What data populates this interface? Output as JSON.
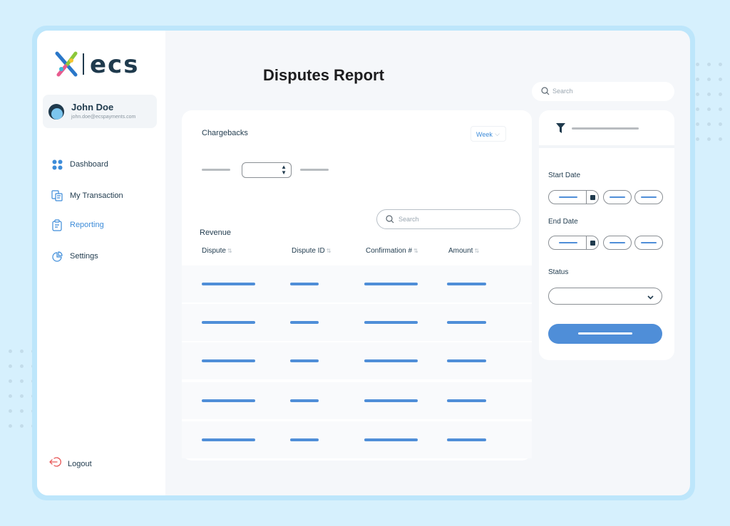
{
  "brand": {
    "wordmark": "ecs"
  },
  "user": {
    "name": "John Doe",
    "email": "john.doe@ecspayments.com"
  },
  "nav": {
    "items": [
      {
        "label": "Dashboard",
        "icon": "grid-icon"
      },
      {
        "label": "My Transaction",
        "icon": "transaction-icon"
      },
      {
        "label": "Reporting",
        "icon": "clipboard-icon",
        "active": true
      },
      {
        "label": "Settings",
        "icon": "pie-chart-icon"
      }
    ],
    "logout_label": "Logout"
  },
  "page": {
    "title": "Disputes Report"
  },
  "top_search": {
    "placeholder": "Search"
  },
  "chargebacks": {
    "title": "Chargebacks",
    "period": "Week"
  },
  "table": {
    "section_title": "Revenue",
    "search_placeholder": "Search",
    "columns": [
      "Dispute",
      "Dispute ID",
      "Confirmation #",
      "Amount"
    ],
    "row_count": 5
  },
  "filters": {
    "start_date_label": "Start Date",
    "end_date_label": "End Date",
    "status_label": "Status"
  },
  "colors": {
    "accent": "#4f8ed8",
    "active_nav": "#3d8cd9",
    "text_dark": "#1f3a4d",
    "background": "#d6f0fd"
  }
}
